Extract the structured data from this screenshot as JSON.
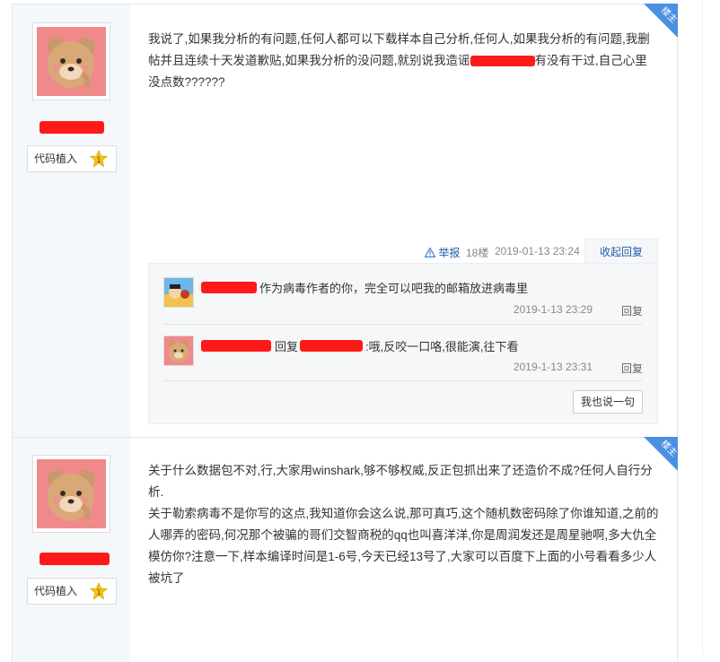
{
  "post1": {
    "badge": "楼主",
    "level_label": "代码植入",
    "level_num": "1",
    "content_a": "我说了,如果我分析的有问题,任何人都可以下载样本自己分析,任何人,如果我分析的有问题,我删帖并且连续十天发道歉贴,如果我分析的没问题,就别说我造谣",
    "content_b": "有没有干过,自己心里没点数??????",
    "report": "举报",
    "floor": "18楼",
    "datetime": "2019-01-13 23:24",
    "collapse": "收起回复",
    "replies": [
      {
        "text": "作为病毒作者的你，完全可以吧我的邮箱放进病毒里",
        "time": "2019-1-13 23:29",
        "action": "回复"
      },
      {
        "prefix": "回复",
        "text": ":哦,反咬一口咯,很能演,往下看",
        "time": "2019-1-13 23:31",
        "action": "回复"
      }
    ],
    "say_button": "我也说一句"
  },
  "post2": {
    "badge": "楼主",
    "level_label": "代码植入",
    "level_num": "1",
    "content": [
      "关于什么数据包不对,行,大家用winshark,够不够权威,反正包抓出来了还造价不成?任何人自行分析.",
      "关于勒索病毒不是你写的这点,我知道你会这么说,那可真巧,这个随机数密码除了你谁知道,之前的人哪弄的密码,何况那个被骗的哥们交智商税的qq也叫喜洋洋,你是周润发还是周星驰啊,多大仇全模仿你?注意一下,样本编译时间是1-6号,今天已经13号了,大家可以百度下上面的小号看看多少人被坑了"
    ]
  },
  "colors": {
    "accent": "#3b7fd9",
    "redact": "#ff1a1a",
    "sidebar": "#f5f8fa"
  },
  "icons": [
    "warning-icon",
    "star-level-icon",
    "bear-avatar",
    "cartoon-avatar"
  ]
}
